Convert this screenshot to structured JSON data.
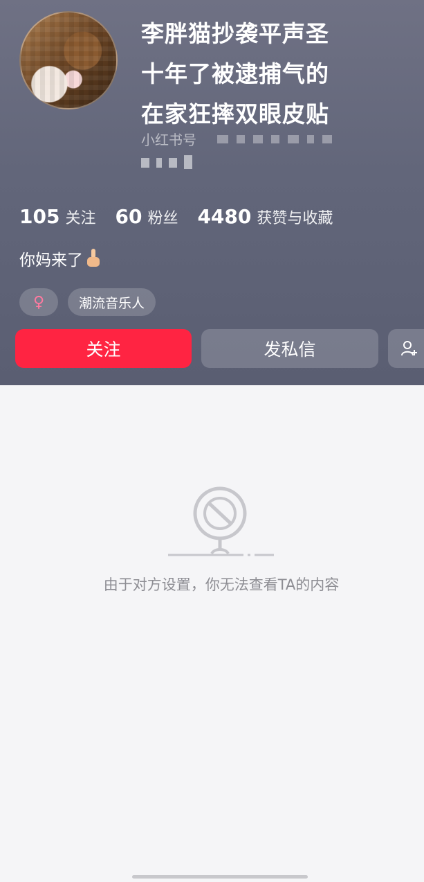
{
  "profile": {
    "nickname_lines": [
      "李胖猫抄袭平声圣",
      "十年了被逮捕气的",
      "在家狂摔双眼皮贴"
    ],
    "id_label": "小红书号",
    "bio": "你妈来了",
    "bio_emoji": "middle-finger-emoji",
    "gender_icon": "♀",
    "tag": "潮流音乐人"
  },
  "stats": [
    {
      "value": "105",
      "label": "关注"
    },
    {
      "value": "60",
      "label": "粉丝"
    },
    {
      "value": "4480",
      "label": "获赞与收藏"
    }
  ],
  "actions": {
    "follow_label": "关注",
    "message_label": "发私信",
    "add_friend_icon": "add-user-icon"
  },
  "empty_state": {
    "message": "由于对方设置，你无法查看TA的内容",
    "icon": "blocked-sign-icon"
  },
  "colors": {
    "accent": "#ff2442",
    "header_bg": "#62667a",
    "page_bg": "#f5f5f7",
    "muted_text": "#8d8d93"
  }
}
